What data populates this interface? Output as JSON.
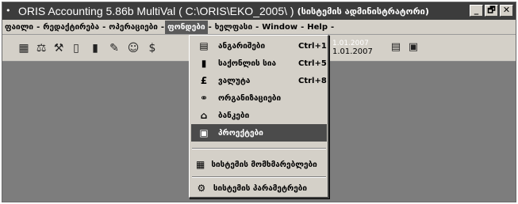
{
  "window": {
    "icon": "• -",
    "title": "ORIS Accounting 5.86b MultiVal  ( C:\\ORIS\\EKO_2005\\ )",
    "subtitle": "(სისტემის ადმინისტრატორი)",
    "controls": [
      "_",
      "🗗",
      "✕"
    ]
  },
  "menubar": {
    "items": [
      {
        "label": "ფაილი",
        "active": false
      },
      {
        "label": "რედაქტირება",
        "active": false
      },
      {
        "label": "ოპერაციები",
        "active": false
      },
      {
        "label": "ფონდები",
        "active": true
      },
      {
        "label": "ხელფასი",
        "active": false
      },
      {
        "label": "Window",
        "active": false
      },
      {
        "label": "Help",
        "active": false
      }
    ],
    "separator": "-"
  },
  "toolbar": {
    "icons": [
      "grid-icon",
      "scale-icon",
      "tools-icon",
      "document-icon",
      "barcode-icon",
      "edit-icon",
      "people-icon",
      "money-icon"
    ],
    "date_ghost": "1.01.2007",
    "date": "1.01.2007",
    "right_icons": [
      "calculator-icon",
      "list-icon"
    ]
  },
  "dropdown": {
    "items": [
      {
        "icon": "ledger-icon",
        "glyph": "▤",
        "label": "ანგარიშები",
        "shortcut": "Ctrl+1",
        "highlight": false
      },
      {
        "icon": "barcode-icon",
        "glyph": "▮",
        "label": "საქონლის სია",
        "shortcut": "Ctrl+5",
        "highlight": false
      },
      {
        "icon": "currency-icon",
        "glyph": "£",
        "label": "ვალუტა",
        "shortcut": "Ctrl+8",
        "highlight": false
      },
      {
        "icon": "handshake-icon",
        "glyph": "⚭",
        "label": "ორგანიზაციები",
        "shortcut": "",
        "highlight": false
      },
      {
        "icon": "bank-icon",
        "glyph": "⌂",
        "label": "ბანკები",
        "shortcut": "",
        "highlight": false
      },
      {
        "icon": "project-icon",
        "glyph": "▣",
        "label": "პროექტები",
        "shortcut": "",
        "highlight": true
      },
      {
        "icon": "settings-icon",
        "glyph": "▦",
        "label": "სისტემის მომხმარებლები",
        "shortcut": "",
        "highlight": false
      },
      {
        "icon": "gears-icon",
        "glyph": "⚙",
        "label": "სისტემის პარამეტრები",
        "shortcut": "",
        "highlight": false
      }
    ]
  },
  "colors": {
    "titlebar": "#3c3c3c",
    "menubar": "#d4d0c8",
    "workspace": "#7d7d7d",
    "highlight": "#4b4b4b"
  }
}
